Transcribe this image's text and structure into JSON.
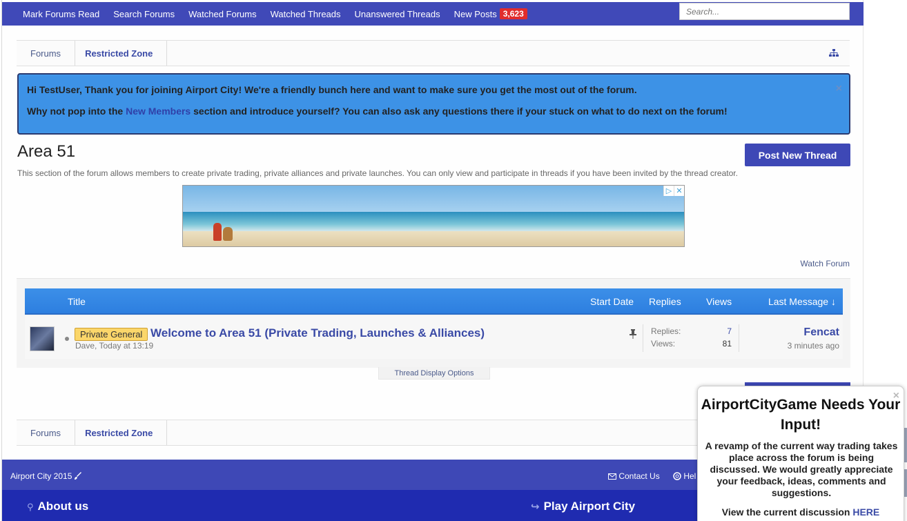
{
  "nav": {
    "links": [
      "Mark Forums Read",
      "Search Forums",
      "Watched Forums",
      "Watched Threads",
      "Unanswered Threads"
    ],
    "new_posts_label": "New Posts",
    "new_posts_count": "3,623",
    "search_placeholder": "Search..."
  },
  "breadcrumb": {
    "home": "Forums",
    "current": "Restricted Zone"
  },
  "notice": {
    "line1": "Hi TestUser, Thank you for joining Airport City! We're a friendly bunch here and want to make sure you get the most out of the forum.",
    "line2_before": "Why not pop into the ",
    "line2_link": "New Members",
    "line2_after": " section and introduce yourself? You can also ask any questions there if your stuck on what to do next on the forum!",
    "close": "×"
  },
  "forum": {
    "title": "Area 51",
    "description": "This section of the forum allows members to create private trading, private alliances and private launches. You can only view and participate in threads if you have been invited by the thread creator.",
    "post_button": "Post New Thread",
    "watch_label": "Watch Forum"
  },
  "ad": {
    "info_icon": "▷",
    "close_icon": "✕"
  },
  "thread_list": {
    "headers": {
      "title": "Title",
      "start_date": "Start Date",
      "replies": "Replies",
      "views": "Views",
      "last_message": "Last Message ↓"
    },
    "threads": [
      {
        "prefix": "Private General",
        "title": "Welcome to Area 51 (Private Trading, Launches & Alliances)",
        "author": "Dave",
        "started": "Today at 13:19",
        "replies_label": "Replies:",
        "replies": "7",
        "views_label": "Views:",
        "views": "81",
        "last_user": "Fencat",
        "last_time": "3 minutes ago"
      }
    ],
    "display_options": "Thread Display Options"
  },
  "footer": {
    "copyright": "Airport City 2015",
    "contact": "Contact Us",
    "help": "Hel",
    "about": "About us",
    "play": "Play Airport City"
  },
  "popup": {
    "title": "AirportCityGame Needs Your Input!",
    "body": "A revamp of the current way trading takes place across the forum is being discussed. We would greatly appreciate your feedback, ideas, comments and suggestions.",
    "cta_text": "View the current discussion ",
    "cta_link": "HERE",
    "close": "×"
  },
  "colors": {
    "nav": "#4049b8",
    "notice": "#3d92e6",
    "list_header": "#2d7fe0",
    "badge": "#e12c2c",
    "prefix": "#fbd66a",
    "footer_dark": "#1f2bb0"
  }
}
